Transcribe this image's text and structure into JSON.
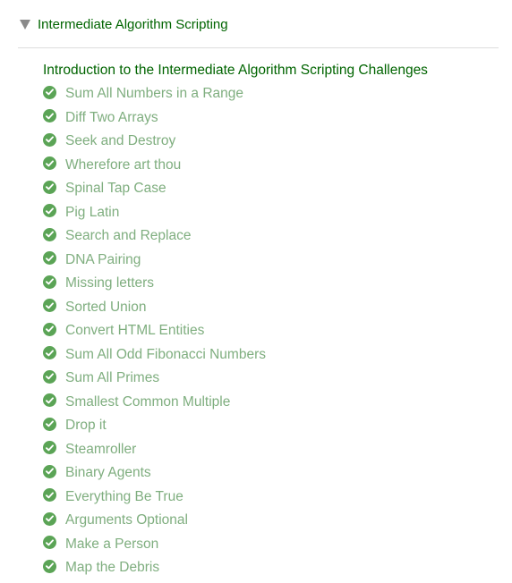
{
  "colors": {
    "header_text": "#006400",
    "completed_text": "#7fae7f",
    "check_fill": "#5ba456",
    "caret": "#8a8a8a",
    "divider": "#dddddd"
  },
  "section": {
    "title": "Intermediate Algorithm Scripting",
    "expanded": true,
    "caret_icon": "caret-down-icon"
  },
  "intro": {
    "label": "Introduction to the Intermediate Algorithm Scripting Challenges"
  },
  "challenges": [
    {
      "label": "Sum All Numbers in a Range",
      "completed": true,
      "icon": "check-circle-icon"
    },
    {
      "label": "Diff Two Arrays",
      "completed": true,
      "icon": "check-circle-icon"
    },
    {
      "label": "Seek and Destroy",
      "completed": true,
      "icon": "check-circle-icon"
    },
    {
      "label": "Wherefore art thou",
      "completed": true,
      "icon": "check-circle-icon"
    },
    {
      "label": "Spinal Tap Case",
      "completed": true,
      "icon": "check-circle-icon"
    },
    {
      "label": "Pig Latin",
      "completed": true,
      "icon": "check-circle-icon"
    },
    {
      "label": "Search and Replace",
      "completed": true,
      "icon": "check-circle-icon"
    },
    {
      "label": "DNA Pairing",
      "completed": true,
      "icon": "check-circle-icon"
    },
    {
      "label": "Missing letters",
      "completed": true,
      "icon": "check-circle-icon"
    },
    {
      "label": "Sorted Union",
      "completed": true,
      "icon": "check-circle-icon"
    },
    {
      "label": "Convert HTML Entities",
      "completed": true,
      "icon": "check-circle-icon"
    },
    {
      "label": "Sum All Odd Fibonacci Numbers",
      "completed": true,
      "icon": "check-circle-icon"
    },
    {
      "label": "Sum All Primes",
      "completed": true,
      "icon": "check-circle-icon"
    },
    {
      "label": "Smallest Common Multiple",
      "completed": true,
      "icon": "check-circle-icon"
    },
    {
      "label": "Drop it",
      "completed": true,
      "icon": "check-circle-icon"
    },
    {
      "label": "Steamroller",
      "completed": true,
      "icon": "check-circle-icon"
    },
    {
      "label": "Binary Agents",
      "completed": true,
      "icon": "check-circle-icon"
    },
    {
      "label": "Everything Be True",
      "completed": true,
      "icon": "check-circle-icon"
    },
    {
      "label": "Arguments Optional",
      "completed": true,
      "icon": "check-circle-icon"
    },
    {
      "label": "Make a Person",
      "completed": true,
      "icon": "check-circle-icon"
    },
    {
      "label": "Map the Debris",
      "completed": true,
      "icon": "check-circle-icon"
    }
  ]
}
